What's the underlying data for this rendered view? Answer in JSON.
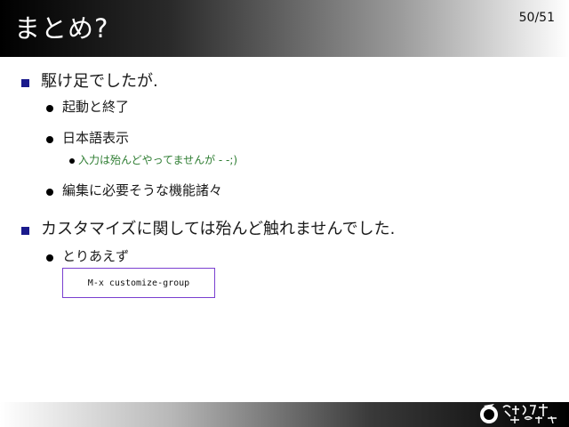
{
  "slide": {
    "title": "まとめ?",
    "page_number": "50/51"
  },
  "items": [
    {
      "text": "駆け足でしたが.",
      "children": [
        {
          "text": "起動と終了"
        },
        {
          "text": "日本語表示",
          "children": [
            {
              "text": "入力は殆んどやってませんが - -;)"
            }
          ]
        },
        {
          "text": "編集に必要そうな機能諸々"
        }
      ]
    },
    {
      "text": "カスタマイズに関しては殆んど触れませんでした.",
      "children": [
        {
          "text": "とりあえず"
        }
      ]
    }
  ],
  "code_block": "M-x customize-group",
  "colors": {
    "bullet_l1": "#1a1a8c",
    "sub_note": "#2e7d32",
    "code_border": "#7a3fd0"
  }
}
